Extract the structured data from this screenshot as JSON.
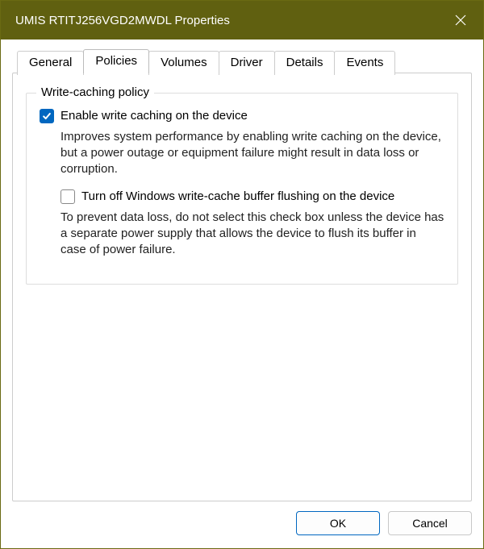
{
  "title": "UMIS RTITJ256VGD2MWDL Properties",
  "tabs": {
    "general": "General",
    "policies": "Policies",
    "volumes": "Volumes",
    "driver": "Driver",
    "details": "Details",
    "events": "Events"
  },
  "group": {
    "legend": "Write-caching policy",
    "opt1_label": "Enable write caching on the device",
    "opt1_desc": "Improves system performance by enabling write caching on the device, but a power outage or equipment failure might result in data loss or corruption.",
    "opt2_label": "Turn off Windows write-cache buffer flushing on the device",
    "opt2_desc": "To prevent data loss, do not select this check box unless the device has a separate power supply that allows the device to flush its buffer in case of power failure."
  },
  "buttons": {
    "ok": "OK",
    "cancel": "Cancel"
  }
}
